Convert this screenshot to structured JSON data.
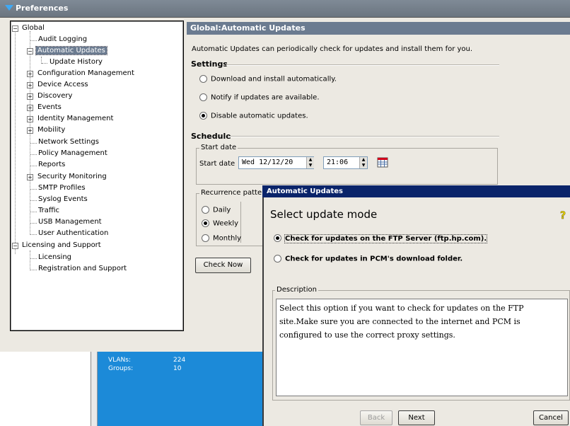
{
  "window": {
    "title": "Preferences"
  },
  "tree": {
    "root_global": "Global",
    "audit_logging": "Audit Logging",
    "automatic_updates": "Automatic Updates",
    "update_history": "Update History",
    "configuration_management": "Configuration Management",
    "device_access": "Device Access",
    "discovery": "Discovery",
    "events": "Events",
    "identity_management": "Identity Management",
    "mobility": "Mobility",
    "network_settings": "Network Settings",
    "policy_management": "Policy Management",
    "reports": "Reports",
    "security_monitoring": "Security Monitoring",
    "smtp_profiles": "SMTP Profiles",
    "syslog_events": "Syslog Events",
    "traffic": "Traffic",
    "usb_management": "USB Management",
    "user_authentication": "User Authentication",
    "root_licensing": "Licensing and Support",
    "licensing": "Licensing",
    "registration": "Registration and Support"
  },
  "panel": {
    "header": "Global:Automatic Updates",
    "description": "Automatic Updates can periodically check for updates and install them for you.",
    "settings_title": "Settings",
    "opt_download": "Download and install automatically.",
    "opt_notify": "Notify if updates are available.",
    "opt_disable": "Disable automatic updates.",
    "schedule_title": "Schedule",
    "start_date_group": "Start date",
    "start_date_label": "Start date",
    "date_value": "Wed   12/12/20",
    "time_value": "21:06",
    "recurrence_group": "Recurrence pattern",
    "rec_daily": "Daily",
    "rec_weekly": "Weekly",
    "rec_monthly": "Monthly",
    "check_now": "Check Now"
  },
  "background": {
    "vlans_label": "VLANs:",
    "vlans_value": "224",
    "groups_label": "Groups:",
    "groups_value": "10"
  },
  "dialog": {
    "title": "Automatic Updates",
    "heading": "Select update mode",
    "opt_ftp": "Check for updates on the FTP Server (ftp.hp.com).",
    "opt_folder": "Check for updates in PCM's download folder.",
    "description_group": "Description",
    "description_text": "Select this option if you want to check for updates on the FTP site.Make sure you are connected to the internet and PCM is configured to use the correct proxy settings.",
    "back": "Back",
    "next": "Next",
    "cancel": "Cancel"
  },
  "colors": {
    "selection": "#6b7b90",
    "dialog_title": "#0a246a",
    "background_app": "#1c8ad8",
    "help_icon": "#e8d400"
  },
  "icons": [
    "app-logo-icon",
    "calendar-icon",
    "help-icon"
  ]
}
